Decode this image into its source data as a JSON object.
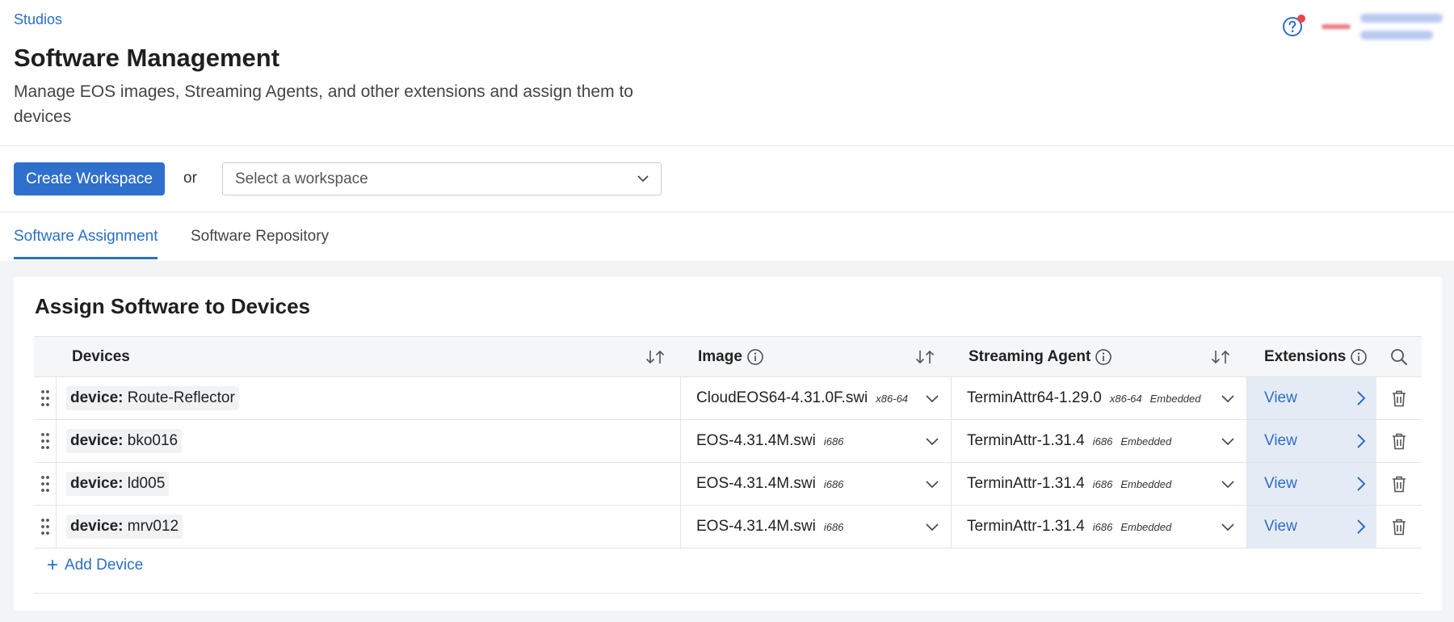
{
  "header": {
    "breadcrumb": "Studios",
    "title": "Software Management",
    "description": "Manage EOS images, Streaming Agents, and other extensions and assign them to devices"
  },
  "toolbar": {
    "create_label": "Create Workspace",
    "or_text": "or",
    "workspace_placeholder": "Select a workspace"
  },
  "tabs": [
    {
      "label": "Software Assignment",
      "active": true
    },
    {
      "label": "Software Repository",
      "active": false
    }
  ],
  "card": {
    "title": "Assign Software to Devices"
  },
  "table": {
    "columns": {
      "devices": "Devices",
      "image": "Image",
      "streaming_agent": "Streaming Agent",
      "extensions": "Extensions"
    },
    "rows": [
      {
        "device_key": "device:",
        "device_value": "Route-Reflector",
        "image": "CloudEOS64-4.31.0F.swi",
        "image_arch": "x86-64",
        "agent": "TerminAttr64-1.29.0",
        "agent_arch": "x86-64",
        "agent_mode": "Embedded",
        "ext_label": "View"
      },
      {
        "device_key": "device:",
        "device_value": "bko016",
        "image": "EOS-4.31.4M.swi",
        "image_arch": "i686",
        "agent": "TerminAttr-1.31.4",
        "agent_arch": "i686",
        "agent_mode": "Embedded",
        "ext_label": "View"
      },
      {
        "device_key": "device:",
        "device_value": "ld005",
        "image": "EOS-4.31.4M.swi",
        "image_arch": "i686",
        "agent": "TerminAttr-1.31.4",
        "agent_arch": "i686",
        "agent_mode": "Embedded",
        "ext_label": "View"
      },
      {
        "device_key": "device:",
        "device_value": "mrv012",
        "image": "EOS-4.31.4M.swi",
        "image_arch": "i686",
        "agent": "TerminAttr-1.31.4",
        "agent_arch": "i686",
        "agent_mode": "Embedded",
        "ext_label": "View"
      }
    ],
    "add_device_label": "Add Device"
  },
  "colors": {
    "accent": "#2f70cd",
    "link": "#2c6fc4",
    "notification": "#e5484d",
    "extensions_bg": "#e5ebf5"
  },
  "icons": [
    "help-icon",
    "sort-icon",
    "info-icon",
    "search-icon",
    "drag-handle-icon",
    "chevron-down-icon",
    "chevron-right-icon",
    "trash-icon",
    "plus-icon"
  ]
}
